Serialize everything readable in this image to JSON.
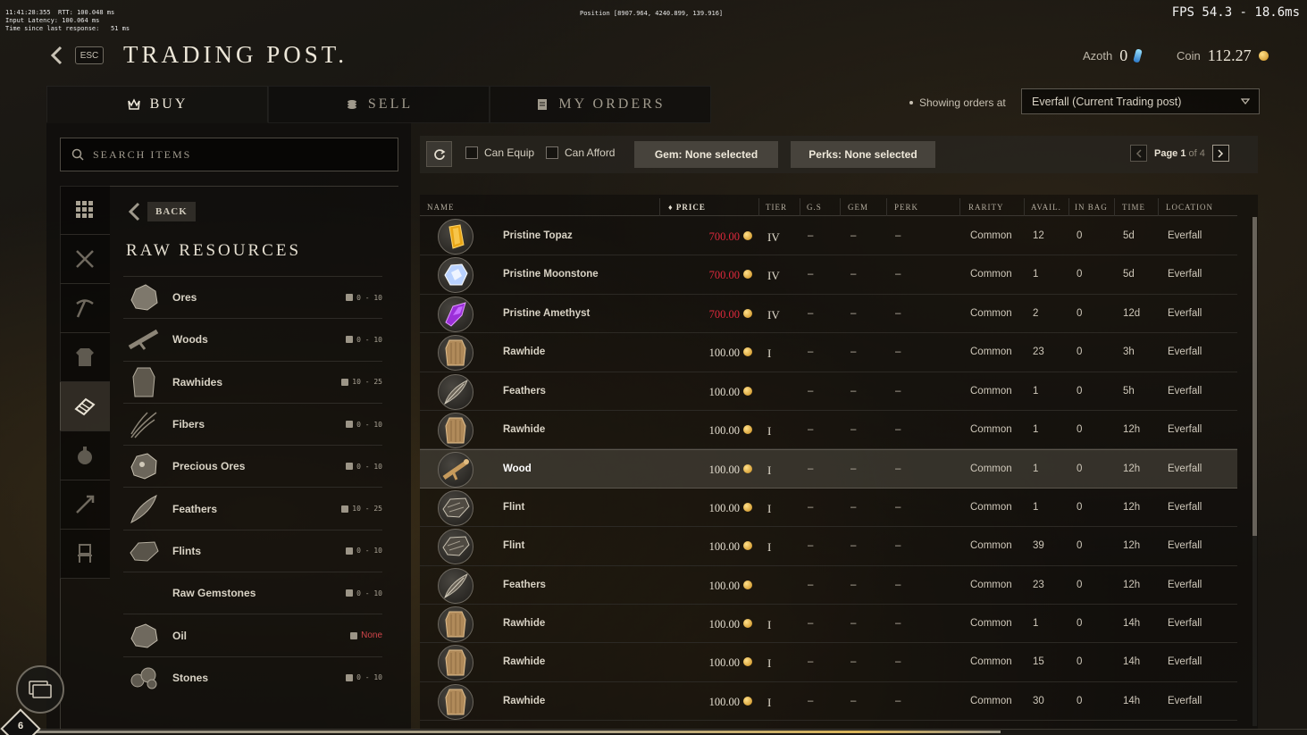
{
  "debug": {
    "line1": "11:41:28:355  RTT: 100.048 ms",
    "line2": "Input Latency: 100.064 ms",
    "line3": "Time since last response:   51 ms",
    "position": "Position [8907.964, 4240.899, 139.916]",
    "fps": "FPS 54.3 - 18.6ms"
  },
  "header": {
    "esc": "ESC",
    "title": "TRADING POST.",
    "azoth_label": "Azoth",
    "azoth_value": "0",
    "coin_label": "Coin",
    "coin_value": "112.27"
  },
  "tabs": [
    {
      "label": "BUY",
      "icon": "crown-icon",
      "active": true
    },
    {
      "label": "SELL",
      "icon": "coins-icon",
      "active": false
    },
    {
      "label": "MY ORDERS",
      "icon": "document-icon",
      "active": false
    }
  ],
  "showing": {
    "label": "Showing orders at",
    "location": "Everfall (Current Trading post)"
  },
  "search": {
    "placeholder": "SEARCH ITEMS"
  },
  "sidebar": {
    "categories": [
      "grid-icon",
      "swords-icon",
      "pickaxe-icon",
      "armor-icon",
      "resources-icon",
      "potion-icon",
      "arrow-icon",
      "furniture-icon"
    ],
    "active_index": 4,
    "back_label": "BACK",
    "title": "RAW RESOURCES",
    "items": [
      {
        "name": "Ores",
        "range": "0 - 10",
        "icon": "ore-icon"
      },
      {
        "name": "Woods",
        "range": "0 - 10",
        "icon": "wood-icon"
      },
      {
        "name": "Rawhides",
        "range": "10 - 25",
        "icon": "rawhide-icon"
      },
      {
        "name": "Fibers",
        "range": "0 - 10",
        "icon": "fiber-icon"
      },
      {
        "name": "Precious Ores",
        "range": "0 - 10",
        "icon": "precious-ore-icon"
      },
      {
        "name": "Feathers",
        "range": "10 - 25",
        "icon": "feather-icon"
      },
      {
        "name": "Flints",
        "range": "0 - 10",
        "icon": "flint-icon"
      },
      {
        "name": "Raw Gemstones",
        "range": "0 - 10",
        "icon": ""
      },
      {
        "name": "Oil",
        "range": "None",
        "icon": "oil-icon"
      },
      {
        "name": "Stones",
        "range": "0 - 10",
        "icon": "stone-icon"
      }
    ]
  },
  "filters": {
    "can_equip": "Can Equip",
    "can_afford": "Can Afford",
    "gem": "Gem: None selected",
    "perks": "Perks: None selected",
    "page_label": "Page",
    "page_current": "1",
    "page_of": "of 4"
  },
  "table": {
    "columns": [
      "NAME",
      "PRICE",
      "TIER",
      "G.S",
      "GEM",
      "PERK",
      "RARITY",
      "AVAIL.",
      "IN BAG",
      "TIME",
      "LOCATION"
    ],
    "rows": [
      {
        "name": "Pristine Topaz",
        "price": "700.00",
        "red": true,
        "tier": "IV",
        "gs": "–",
        "gem": "–",
        "perk": "–",
        "rarity": "Common",
        "avail": "12",
        "inbag": "0",
        "time": "5d",
        "location": "Everfall",
        "icon": "topaz"
      },
      {
        "name": "Pristine Moonstone",
        "price": "700.00",
        "red": true,
        "tier": "IV",
        "gs": "–",
        "gem": "–",
        "perk": "–",
        "rarity": "Common",
        "avail": "1",
        "inbag": "0",
        "time": "5d",
        "location": "Everfall",
        "icon": "moonstone"
      },
      {
        "name": "Pristine Amethyst",
        "price": "700.00",
        "red": true,
        "tier": "IV",
        "gs": "–",
        "gem": "–",
        "perk": "–",
        "rarity": "Common",
        "avail": "2",
        "inbag": "0",
        "time": "12d",
        "location": "Everfall",
        "icon": "amethyst"
      },
      {
        "name": "Rawhide",
        "price": "100.00",
        "red": false,
        "tier": "I",
        "gs": "–",
        "gem": "–",
        "perk": "–",
        "rarity": "Common",
        "avail": "23",
        "inbag": "0",
        "time": "3h",
        "location": "Everfall",
        "icon": "rawhide"
      },
      {
        "name": "Feathers",
        "price": "100.00",
        "red": false,
        "tier": "",
        "gs": "–",
        "gem": "–",
        "perk": "–",
        "rarity": "Common",
        "avail": "1",
        "inbag": "0",
        "time": "5h",
        "location": "Everfall",
        "icon": "feather"
      },
      {
        "name": "Rawhide",
        "price": "100.00",
        "red": false,
        "tier": "I",
        "gs": "–",
        "gem": "–",
        "perk": "–",
        "rarity": "Common",
        "avail": "1",
        "inbag": "0",
        "time": "12h",
        "location": "Everfall",
        "icon": "rawhide"
      },
      {
        "name": "Wood",
        "price": "100.00",
        "red": false,
        "tier": "I",
        "gs": "–",
        "gem": "–",
        "perk": "–",
        "rarity": "Common",
        "avail": "1",
        "inbag": "0",
        "time": "12h",
        "location": "Everfall",
        "icon": "wood",
        "highlight": true
      },
      {
        "name": "Flint",
        "price": "100.00",
        "red": false,
        "tier": "I",
        "gs": "–",
        "gem": "–",
        "perk": "–",
        "rarity": "Common",
        "avail": "1",
        "inbag": "0",
        "time": "12h",
        "location": "Everfall",
        "icon": "flint"
      },
      {
        "name": "Flint",
        "price": "100.00",
        "red": false,
        "tier": "I",
        "gs": "–",
        "gem": "–",
        "perk": "–",
        "rarity": "Common",
        "avail": "39",
        "inbag": "0",
        "time": "12h",
        "location": "Everfall",
        "icon": "flint"
      },
      {
        "name": "Feathers",
        "price": "100.00",
        "red": false,
        "tier": "",
        "gs": "–",
        "gem": "–",
        "perk": "–",
        "rarity": "Common",
        "avail": "23",
        "inbag": "0",
        "time": "12h",
        "location": "Everfall",
        "icon": "feather"
      },
      {
        "name": "Rawhide",
        "price": "100.00",
        "red": false,
        "tier": "I",
        "gs": "–",
        "gem": "–",
        "perk": "–",
        "rarity": "Common",
        "avail": "1",
        "inbag": "0",
        "time": "14h",
        "location": "Everfall",
        "icon": "rawhide"
      },
      {
        "name": "Rawhide",
        "price": "100.00",
        "red": false,
        "tier": "I",
        "gs": "–",
        "gem": "–",
        "perk": "–",
        "rarity": "Common",
        "avail": "15",
        "inbag": "0",
        "time": "14h",
        "location": "Everfall",
        "icon": "rawhide"
      },
      {
        "name": "Rawhide",
        "price": "100.00",
        "red": false,
        "tier": "I",
        "gs": "–",
        "gem": "–",
        "perk": "–",
        "rarity": "Common",
        "avail": "30",
        "inbag": "0",
        "time": "14h",
        "location": "Everfall",
        "icon": "rawhide"
      }
    ]
  },
  "footer": {
    "level": "6"
  },
  "colors": {
    "accent": "#e0293d",
    "gold": "#d9b45a",
    "panel": "#14130f"
  }
}
